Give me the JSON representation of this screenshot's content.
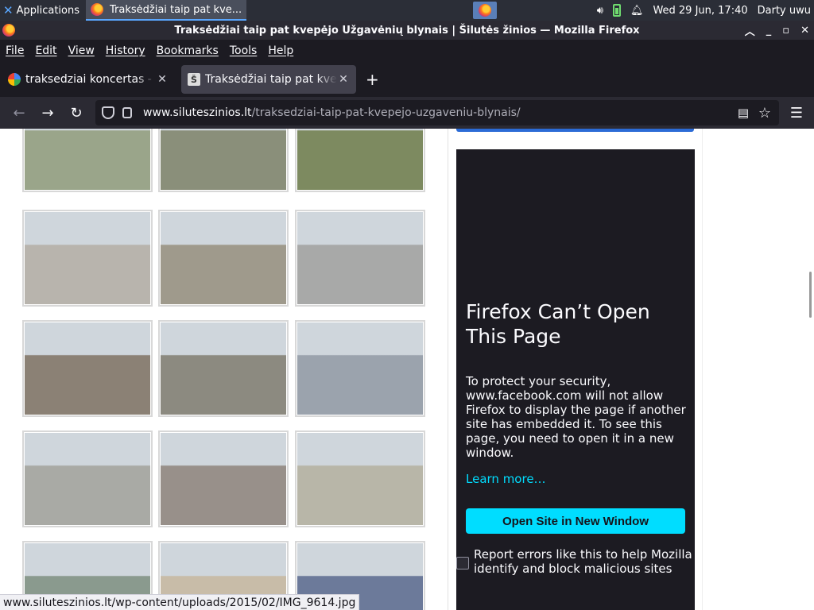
{
  "taskbar": {
    "applications_label": "Applications",
    "task_title": "Traksėdžiai taip pat kve...",
    "datetime": "Wed 29 Jun, 17:40",
    "user": "Darty uwu"
  },
  "window": {
    "title": "Traksėdžiai taip pat kvepėjo Užgavėnių blynais | Šilutės žinios — Mozilla Firefox"
  },
  "menu": [
    "File",
    "Edit",
    "View",
    "History",
    "Bookmarks",
    "Tools",
    "Help"
  ],
  "tabs": [
    {
      "title": "traksedziai koncertas - Google"
    },
    {
      "title": "Traksėdžiai taip pat kvepėjo"
    }
  ],
  "address": {
    "domain": "www.siluteszinios.lt",
    "path": "/traksedziai-taip-pat-kvepejo-uzgaveniu-blynais/"
  },
  "gallery": {
    "tone_colors": [
      [
        "#9aa58a",
        "#8a8f7a",
        "#7d8a60"
      ],
      [
        "#b8b4ad",
        "#9f9a8c",
        "#a8a9a8"
      ],
      [
        "#8b8175",
        "#8c8a80",
        "#9ba3ad"
      ],
      [
        "#a9aaa5",
        "#98908a",
        "#b8b6a8"
      ],
      [
        "#8a9a8e",
        "#c8bca8",
        "#6c7a9a"
      ]
    ]
  },
  "error_panel": {
    "heading": "Firefox Can’t Open This Page",
    "message": "To protect your security, www.facebook.com will not allow Firefox to display the page if another site has embedded it. To see this page, you need to open it in a new window.",
    "learn_more": "Learn more…",
    "open_button": "Open Site in New Window",
    "report_label": "Report errors like this to help Mozilla identify and block malicious sites"
  },
  "status_url": "www.siluteszinios.lt/wp-content/uploads/2015/02/IMG_9614.jpg",
  "colors": {
    "accent": "#00ddff",
    "dark_bg": "#1c1b22"
  }
}
